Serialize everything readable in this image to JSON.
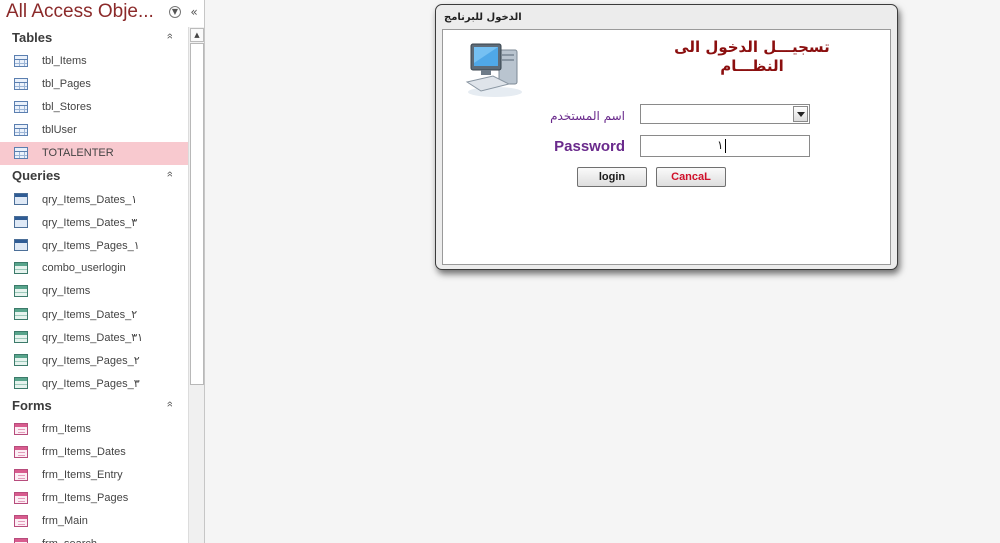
{
  "nav": {
    "title": "All Access Obje...",
    "groups": [
      {
        "label": "Tables",
        "items": [
          {
            "label": "tbl_Items",
            "icon": "table-icon"
          },
          {
            "label": "tbl_Pages",
            "icon": "table-icon"
          },
          {
            "label": "tbl_Stores",
            "icon": "table-icon"
          },
          {
            "label": "tblUser",
            "icon": "table-icon"
          },
          {
            "label": "TOTALENTER",
            "icon": "table-icon",
            "selected": true
          }
        ]
      },
      {
        "label": "Queries",
        "items": [
          {
            "label": "qry_Items_Dates_١",
            "icon": "select-query-icon"
          },
          {
            "label": "qry_Items_Dates_٣",
            "icon": "select-query-icon"
          },
          {
            "label": "qry_Items_Pages_١",
            "icon": "select-query-icon"
          },
          {
            "label": "combo_userlogin",
            "icon": "query-icon"
          },
          {
            "label": "qry_Items",
            "icon": "query-icon"
          },
          {
            "label": "qry_Items_Dates_٢",
            "icon": "query-icon"
          },
          {
            "label": "qry_Items_Dates_٣١",
            "icon": "query-icon"
          },
          {
            "label": "qry_Items_Pages_٢",
            "icon": "query-icon"
          },
          {
            "label": "qry_Items_Pages_٣",
            "icon": "query-icon"
          }
        ]
      },
      {
        "label": "Forms",
        "items": [
          {
            "label": "frm_Items",
            "icon": "form-icon"
          },
          {
            "label": "frm_Items_Dates",
            "icon": "form-icon"
          },
          {
            "label": "frm_Items_Entry",
            "icon": "form-icon"
          },
          {
            "label": "frm_Items_Pages",
            "icon": "form-icon"
          },
          {
            "label": "frm_Main",
            "icon": "form-icon"
          },
          {
            "label": "frm_search",
            "icon": "form-icon"
          }
        ]
      }
    ]
  },
  "dialog": {
    "title": "الدخول للبرنامج",
    "heading_line1": "تسجيـــل الدخول الى",
    "heading_line2": "النظـــام",
    "username_label": "اسم المستخدم",
    "username_value": "",
    "password_label": "Password",
    "password_value": "١",
    "login_label": "login",
    "cancel_label": "CancaL"
  },
  "colors": {
    "nav_title": "#8b2a2a",
    "selected_row": "#f8c9cf",
    "heading": "#8b0f0f",
    "label_purple": "#6a2a8c",
    "cancel_text": "#d0102a"
  }
}
